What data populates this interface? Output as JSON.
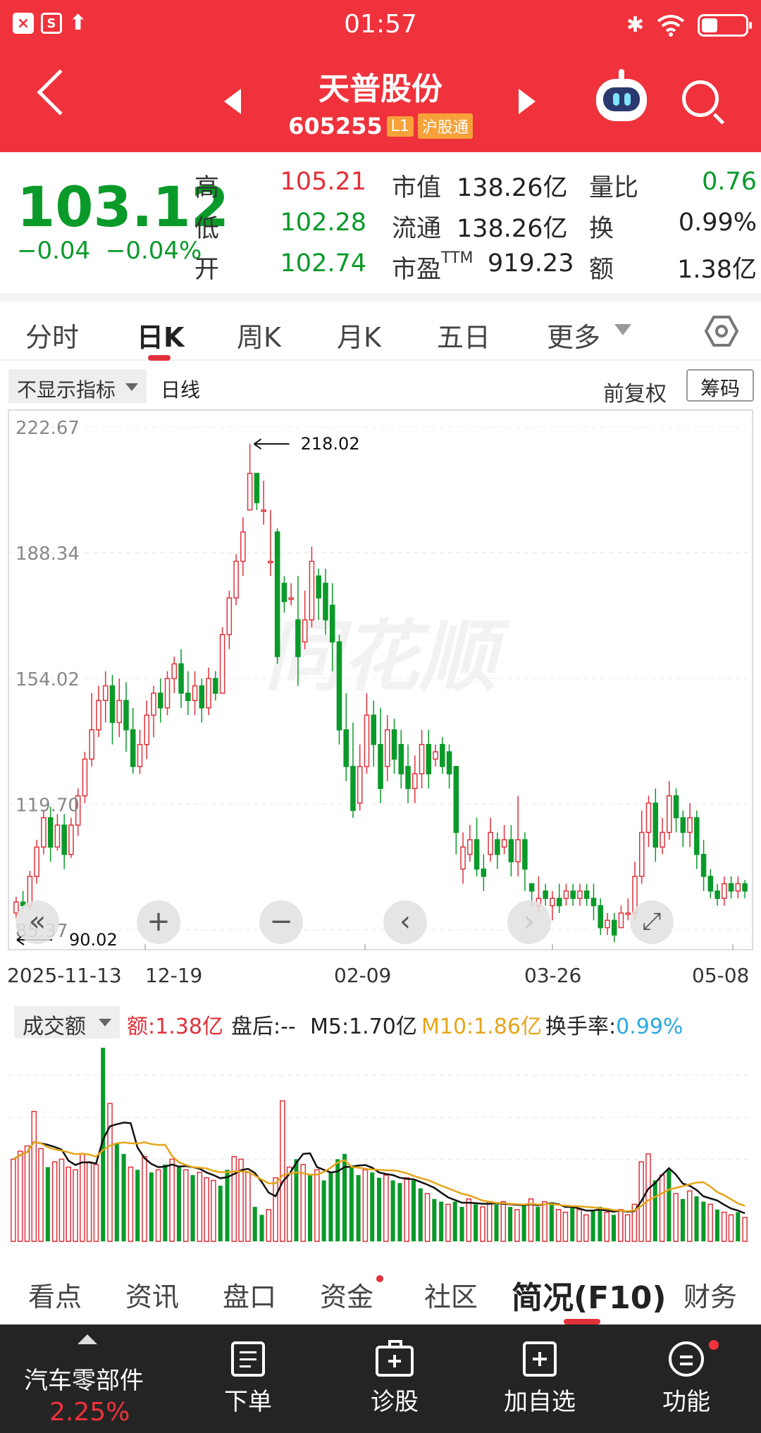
{
  "status_bar": {
    "time": "01:57",
    "icon_box_1": "×",
    "icon_box_2": "S"
  },
  "header": {
    "stock_name": "天普股份",
    "stock_code": "605255",
    "tag_level": "L1",
    "tag_connect": "沪股通"
  },
  "quote": {
    "price": "103.12",
    "change": "−0.04",
    "change_pct": "−0.04%",
    "high_label": "高",
    "high": "105.21",
    "low_label": "低",
    "low": "102.28",
    "open_label": "开",
    "open": "102.74",
    "mcap_label": "市值",
    "mcap": "138.26亿",
    "float_label": "流通",
    "float": "138.26亿",
    "pe_label": "市盈TTM",
    "pe": "919.23",
    "vol_ratio_label": "量比",
    "vol_ratio": "0.76",
    "turnover_label": "换",
    "turnover": "0.99%",
    "amount_label": "额",
    "amount": "1.38亿"
  },
  "period_tabs": [
    "分时",
    "日K",
    "周K",
    "月K",
    "五日",
    "更多"
  ],
  "chart_toolbar": {
    "indicator": "不显示指标",
    "line_type": "日线",
    "adjust": "前复权",
    "chips": "筹码"
  },
  "chart_controls": {
    "zoom_in": "+",
    "zoom_out": "−",
    "prev": "‹",
    "next": "›",
    "rewind": "«",
    "fullscreen": "⤢"
  },
  "watermark": "同花顺",
  "colors": {
    "up": "#e0313b",
    "down": "#0a9a2a",
    "header_bg": "#ef323c",
    "ma10": "#e6a519",
    "turnover_val": "#2aa8e0"
  },
  "chart_data": {
    "type": "candlestick",
    "ylim": [
      85.37,
      222.67
    ],
    "y_ticks": [
      "222.67",
      "188.34",
      "154.02",
      "119.70",
      "85.37"
    ],
    "x_ticks": [
      "2025-11-13",
      "12-19",
      "02-09",
      "03-26",
      "05-08"
    ],
    "annotations": {
      "max": "218.02",
      "min": "90.02"
    },
    "candles": [
      [
        90,
        93,
        88.5,
        94.5
      ],
      [
        93,
        92,
        91,
        96
      ],
      [
        92,
        100,
        91,
        101.5
      ],
      [
        100,
        108,
        98,
        110
      ],
      [
        108,
        116,
        106,
        118
      ],
      [
        116,
        108,
        104,
        119
      ],
      [
        108,
        114,
        107,
        117
      ],
      [
        114,
        106,
        102,
        117
      ],
      [
        106,
        114,
        105,
        116
      ],
      [
        114,
        122,
        111,
        124
      ],
      [
        122,
        132,
        120,
        134
      ],
      [
        132,
        140,
        130,
        150
      ],
      [
        140,
        148,
        138,
        152
      ],
      [
        148,
        152,
        142,
        156
      ],
      [
        152,
        142,
        136,
        155
      ],
      [
        142,
        148,
        138,
        154
      ],
      [
        148,
        140,
        134,
        153
      ],
      [
        140,
        130,
        128,
        146
      ],
      [
        130,
        136,
        128,
        140
      ],
      [
        136,
        144,
        132,
        148
      ],
      [
        144,
        150,
        138,
        152
      ],
      [
        150,
        146,
        142,
        154
      ],
      [
        146,
        154,
        144,
        156
      ],
      [
        154,
        158,
        150,
        160
      ],
      [
        158,
        150,
        146,
        162
      ],
      [
        150,
        148,
        144,
        156
      ],
      [
        148,
        152,
        144,
        156
      ],
      [
        152,
        146,
        142,
        154
      ],
      [
        146,
        154,
        144,
        157
      ],
      [
        154,
        150,
        148,
        156
      ],
      [
        150,
        166,
        150,
        168
      ],
      [
        166,
        176,
        162,
        178
      ],
      [
        176,
        186,
        174,
        188
      ],
      [
        186,
        194,
        182,
        198
      ],
      [
        200,
        210,
        200,
        218
      ],
      [
        210,
        202,
        200,
        209
      ],
      [
        200,
        200,
        196,
        208
      ],
      [
        186,
        186,
        182,
        200
      ],
      [
        194,
        160,
        158,
        195
      ],
      [
        180,
        175,
        172,
        182
      ],
      [
        176,
        176,
        174,
        180
      ],
      [
        170,
        160,
        152,
        182
      ],
      [
        164,
        170,
        162,
        178
      ],
      [
        170,
        186,
        168,
        190
      ],
      [
        182,
        176,
        170,
        184
      ],
      [
        180,
        170,
        166,
        184
      ],
      [
        174,
        164,
        156,
        180
      ],
      [
        164,
        140,
        136,
        166
      ],
      [
        140,
        130,
        126,
        150
      ],
      [
        130,
        118,
        116,
        142
      ],
      [
        120,
        130,
        118,
        136
      ],
      [
        130,
        144,
        128,
        150
      ],
      [
        144,
        136,
        130,
        148
      ],
      [
        136,
        124,
        120,
        146
      ],
      [
        130,
        140,
        126,
        144
      ],
      [
        140,
        132,
        128,
        143
      ],
      [
        136,
        128,
        124,
        140
      ],
      [
        130,
        124,
        120,
        136
      ],
      [
        124,
        128,
        120,
        133
      ],
      [
        128,
        136,
        124,
        140
      ],
      [
        136,
        128,
        124,
        140
      ],
      [
        132,
        134,
        130,
        136
      ],
      [
        136,
        130,
        128,
        138
      ],
      [
        134,
        128,
        124,
        136
      ],
      [
        130,
        112,
        106,
        130
      ],
      [
        102,
        108,
        98,
        112
      ],
      [
        106,
        110,
        104,
        114
      ],
      [
        110,
        102,
        100,
        116
      ],
      [
        102,
        100,
        96,
        106
      ],
      [
        106,
        112,
        104,
        116
      ],
      [
        110,
        106,
        102,
        112
      ],
      [
        108,
        110,
        106,
        114
      ],
      [
        110,
        104,
        100,
        114
      ],
      [
        104,
        110,
        100,
        122
      ],
      [
        110,
        102,
        96,
        112
      ],
      [
        98,
        96,
        92,
        98
      ],
      [
        92,
        94,
        90,
        100
      ],
      [
        96,
        94,
        92,
        98
      ],
      [
        92,
        94,
        88,
        96
      ],
      [
        94,
        92,
        90,
        98
      ],
      [
        94,
        96,
        92,
        98
      ],
      [
        96,
        94,
        92,
        98
      ],
      [
        94,
        96,
        92,
        98
      ],
      [
        96,
        94,
        92,
        98
      ],
      [
        94,
        92,
        88,
        98
      ],
      [
        92,
        86,
        84,
        94
      ],
      [
        86,
        88,
        84,
        90
      ],
      [
        88,
        84,
        82,
        90
      ],
      [
        86,
        90,
        86,
        92
      ],
      [
        90,
        90,
        88,
        94
      ],
      [
        90,
        100,
        88,
        104
      ],
      [
        100,
        112,
        98,
        118
      ],
      [
        112,
        120,
        108,
        122
      ],
      [
        120,
        108,
        104,
        124
      ],
      [
        108,
        112,
        106,
        116
      ],
      [
        112,
        122,
        110,
        126
      ],
      [
        122,
        116,
        112,
        124
      ],
      [
        116,
        112,
        108,
        118
      ],
      [
        112,
        116,
        108,
        120
      ],
      [
        116,
        106,
        102,
        118
      ],
      [
        106,
        100,
        96,
        110
      ],
      [
        100,
        96,
        94,
        102
      ],
      [
        96,
        94,
        92,
        98
      ],
      [
        94,
        98,
        92,
        100
      ],
      [
        98,
        96,
        94,
        100
      ],
      [
        96,
        98,
        94,
        100
      ],
      [
        98,
        96,
        94,
        99
      ]
    ]
  },
  "volume": {
    "selector": "成交额",
    "amount_label": "额:1.38亿",
    "after_label": "盘后:--",
    "m5_label": "M5:1.70亿",
    "m10_label": "M10:1.86亿",
    "turnover_label": "换手率:",
    "turnover_value": "0.99%",
    "bars": [
      [
        3.1,
        1
      ],
      [
        3.4,
        1
      ],
      [
        3.6,
        1
      ],
      [
        4.9,
        1
      ],
      [
        3.5,
        1
      ],
      [
        2.8,
        -1
      ],
      [
        3.0,
        1
      ],
      [
        3.1,
        1
      ],
      [
        2.8,
        1
      ],
      [
        2.7,
        1
      ],
      [
        3.3,
        1
      ],
      [
        3.0,
        1
      ],
      [
        2.9,
        1
      ],
      [
        7.3,
        -1
      ],
      [
        5.2,
        1
      ],
      [
        3.7,
        -1
      ],
      [
        3.3,
        -1
      ],
      [
        2.8,
        1
      ],
      [
        2.7,
        -1
      ],
      [
        3.2,
        1
      ],
      [
        2.6,
        -1
      ],
      [
        2.7,
        1
      ],
      [
        2.9,
        -1
      ],
      [
        3.1,
        1
      ],
      [
        2.8,
        -1
      ],
      [
        2.7,
        1
      ],
      [
        2.5,
        -1
      ],
      [
        2.6,
        1
      ],
      [
        2.4,
        1
      ],
      [
        2.3,
        1
      ],
      [
        2.1,
        -1
      ],
      [
        2.7,
        -1
      ],
      [
        3.2,
        1
      ],
      [
        3.1,
        1
      ],
      [
        2.6,
        1
      ],
      [
        1.3,
        -1
      ],
      [
        1.0,
        -1
      ],
      [
        1.2,
        1
      ],
      [
        2.4,
        1
      ],
      [
        5.3,
        1
      ],
      [
        2.8,
        1
      ],
      [
        3.1,
        -1
      ],
      [
        2.9,
        1
      ],
      [
        2.5,
        -1
      ],
      [
        2.7,
        1
      ],
      [
        2.3,
        -1
      ],
      [
        2.6,
        -1
      ],
      [
        3.1,
        -1
      ],
      [
        3.3,
        -1
      ],
      [
        2.8,
        -1
      ],
      [
        2.5,
        -1
      ],
      [
        2.7,
        1
      ],
      [
        2.6,
        -1
      ],
      [
        2.4,
        -1
      ],
      [
        2.5,
        1
      ],
      [
        2.3,
        -1
      ],
      [
        2.2,
        -1
      ],
      [
        2.4,
        1
      ],
      [
        2.3,
        -1
      ],
      [
        2.0,
        -1
      ],
      [
        1.8,
        1
      ],
      [
        1.6,
        -1
      ],
      [
        1.5,
        -1
      ],
      [
        1.4,
        1
      ],
      [
        1.5,
        -1
      ],
      [
        1.3,
        -1
      ],
      [
        1.6,
        1
      ],
      [
        1.4,
        -1
      ],
      [
        1.3,
        1
      ],
      [
        1.5,
        1
      ],
      [
        1.4,
        -1
      ],
      [
        1.5,
        1
      ],
      [
        1.3,
        -1
      ],
      [
        1.2,
        1
      ],
      [
        1.4,
        -1
      ],
      [
        1.6,
        1
      ],
      [
        1.3,
        -1
      ],
      [
        1.5,
        1
      ],
      [
        1.4,
        -1
      ],
      [
        1.2,
        1
      ],
      [
        1.1,
        1
      ],
      [
        1.3,
        -1
      ],
      [
        1.2,
        1
      ],
      [
        1.0,
        1
      ],
      [
        1.2,
        -1
      ],
      [
        1.3,
        -1
      ],
      [
        1.1,
        1
      ],
      [
        1.0,
        -1
      ],
      [
        1.2,
        1
      ],
      [
        1.0,
        1
      ],
      [
        1.4,
        1
      ],
      [
        3.0,
        1
      ],
      [
        3.3,
        1
      ],
      [
        2.3,
        -1
      ],
      [
        2.5,
        1
      ],
      [
        2.7,
        -1
      ],
      [
        1.8,
        1
      ],
      [
        1.6,
        -1
      ],
      [
        1.9,
        1
      ],
      [
        1.7,
        -1
      ],
      [
        1.5,
        -1
      ],
      [
        1.4,
        1
      ],
      [
        1.2,
        -1
      ],
      [
        1.1,
        1
      ],
      [
        1.0,
        1
      ],
      [
        1.1,
        -1
      ],
      [
        0.9,
        1
      ]
    ],
    "ymax": 7.6
  },
  "info_tabs": [
    "看点",
    "资讯",
    "盘口",
    "资金",
    "社区",
    "简况(F10)",
    "财务"
  ],
  "bottom_bar": {
    "sector_name": "汽车零部件",
    "sector_change": "2.25%",
    "actions": [
      "下单",
      "诊股",
      "加自选",
      "功能"
    ]
  }
}
